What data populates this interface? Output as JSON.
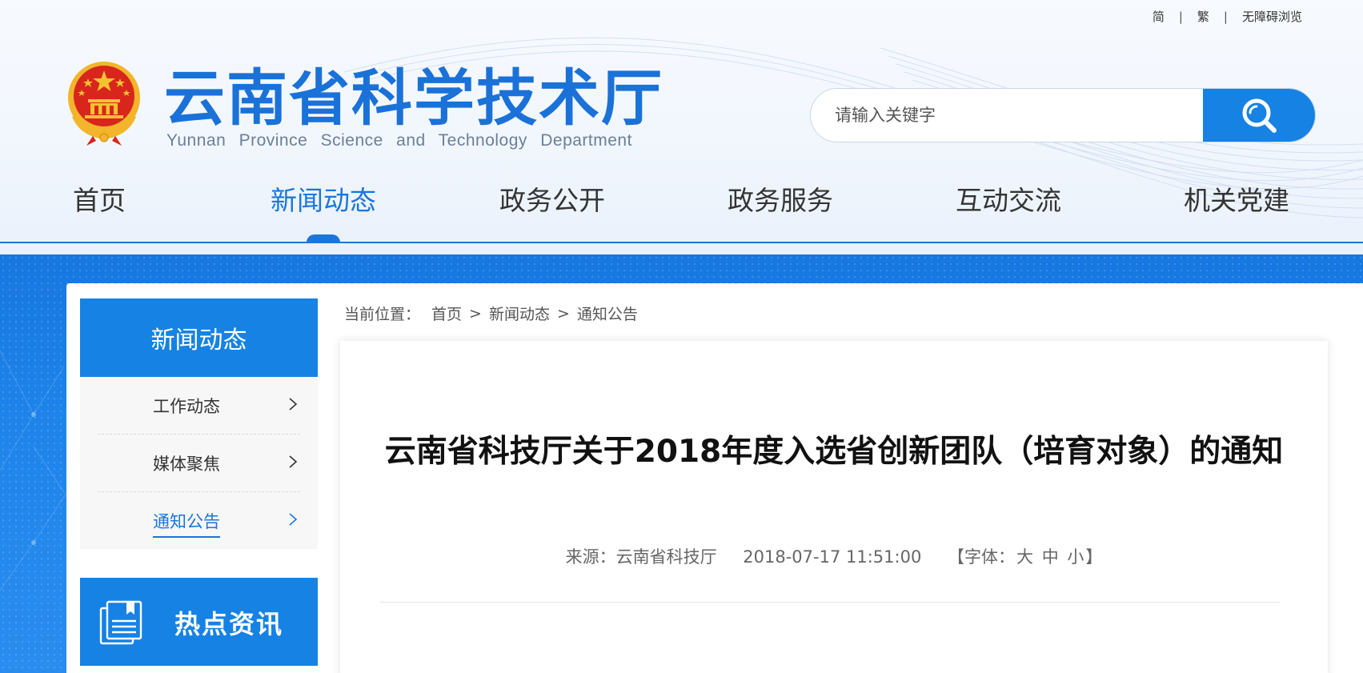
{
  "toplinks": {
    "simplified": "简",
    "sep1": "|",
    "traditional": "繁",
    "sep2": "|",
    "accessible": "无障碍浏览"
  },
  "site": {
    "title": "云南省科学技术厅",
    "subtitle": "Yunnan Province Science and Technology Department"
  },
  "search": {
    "placeholder": "请输入关键字"
  },
  "nav": [
    {
      "label": "首页"
    },
    {
      "label": "新闻动态"
    },
    {
      "label": "政务公开"
    },
    {
      "label": "政务服务"
    },
    {
      "label": "互动交流"
    },
    {
      "label": "机关党建"
    }
  ],
  "sidebar": {
    "title": "新闻动态",
    "items": [
      {
        "label": "工作动态"
      },
      {
        "label": "媒体聚焦"
      },
      {
        "label": "通知公告"
      }
    ],
    "hot_label": "热点资讯"
  },
  "breadcrumb": {
    "prefix": "当前位置：",
    "items": [
      "首页",
      "新闻动态",
      "通知公告"
    ],
    "separator": ">"
  },
  "article": {
    "title": "云南省科技厅关于2018年度入选省创新团队（培育对象）的通知",
    "source": "来源：云南省科技厅",
    "date": "2018-07-17 11:51:00",
    "font_prefix": "【字体：",
    "font_large": "大",
    "font_medium": "中",
    "font_small": "小",
    "font_suffix": "】"
  },
  "colors": {
    "brand_blue": "#1582e4",
    "title_blue": "#1a72d8",
    "emblem_red": "#d8261c",
    "emblem_gold": "#f2b52b"
  }
}
